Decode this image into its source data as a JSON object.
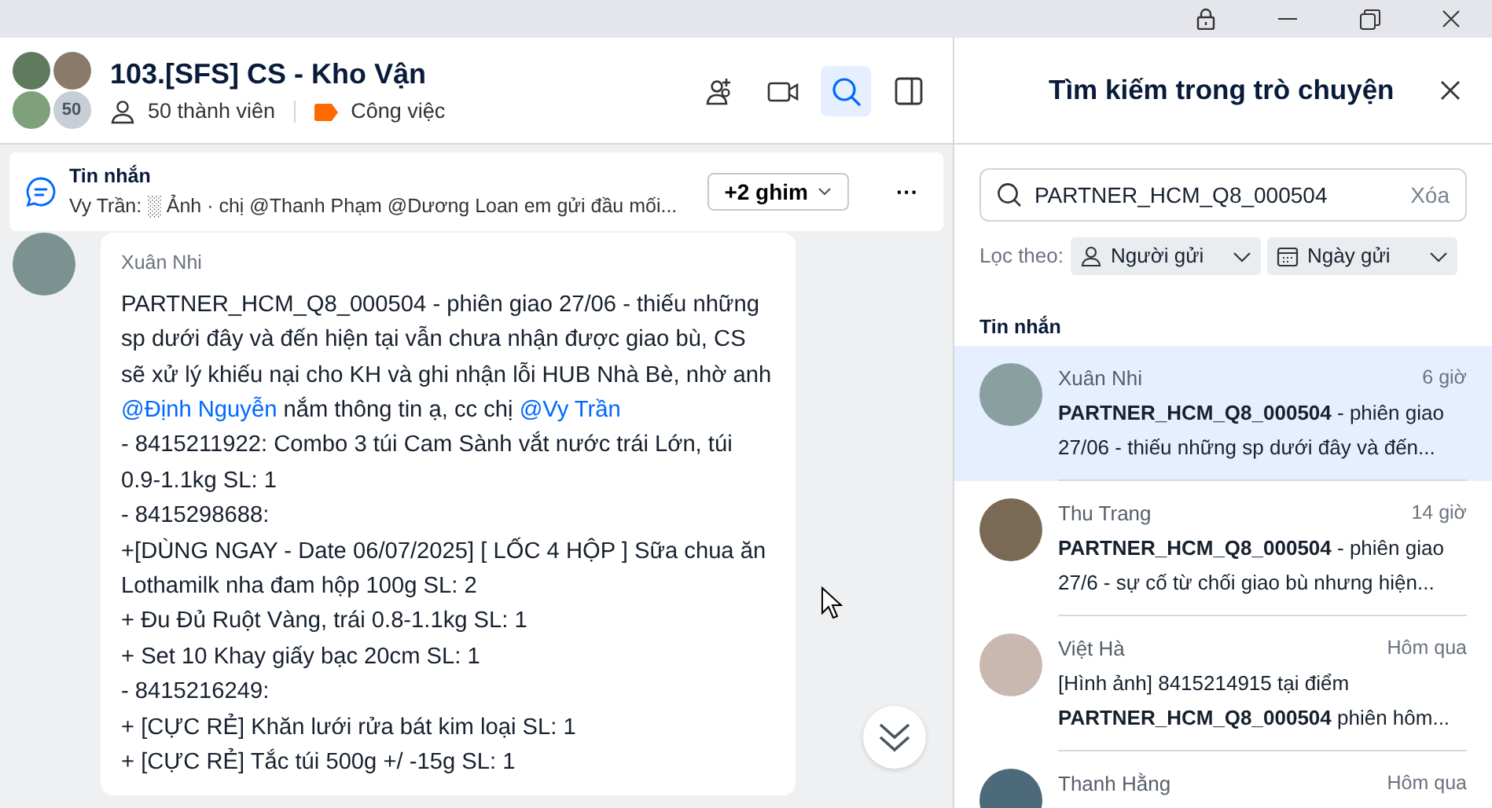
{
  "chat": {
    "title": "103.[SFS] CS - Kho Vận",
    "member_count_badge": "50",
    "members": "50 thành viên",
    "tag": {
      "label": "Công việc",
      "color": "#ff6a00"
    },
    "header_actions": [
      {
        "kind": "add-member",
        "selected": false
      },
      {
        "kind": "video",
        "selected": false
      },
      {
        "kind": "search",
        "selected": true
      },
      {
        "kind": "panel",
        "selected": false
      }
    ],
    "pinned": {
      "title": "Tin nhắn",
      "preview": "Vy Trần: ░ Ảnh · chị @Thanh Phạm @Dương Loan em gửi đầu mối...",
      "pins_button": "+2 ghim",
      "more": "···"
    },
    "message": {
      "sender": "Xuân Nhi",
      "paragraphs": [
        [
          {
            "text": "PARTNER_HCM_Q8_000504 - phiên giao 27/06 - thiếu những sp dưới đây và đến hiện tại vẫn chưa nhận được giao bù, CS sẽ xử lý khiếu nại cho KH và ghi nhận lỗi HUB Nhà Bè, nhờ anh ",
            "mention": false
          },
          {
            "text": "@Định Nguyễn",
            "mention": true
          },
          {
            "text": " nắm thông tin ạ, cc chị ",
            "mention": false
          },
          {
            "text": "@Vy Trần",
            "mention": true
          }
        ],
        [
          {
            "text": "- 8415211922: Combo 3 túi Cam Sành vắt nước trái Lớn, túi 0.9-1.1kg SL: 1",
            "mention": false
          }
        ],
        [
          {
            "text": "- 8415298688:",
            "mention": false
          }
        ],
        [
          {
            "text": "+[DÙNG NGAY - Date 06/07/2025] [ LỐC 4 HỘP ] Sữa chua ăn Lothamilk nha đam hộp 100g SL: 2",
            "mention": false
          }
        ],
        [
          {
            "text": "+ Đu Đủ Ruột Vàng, trái 0.8-1.1kg SL: 1",
            "mention": false
          }
        ],
        [
          {
            "text": "+ Set 10 Khay giấy bạc 20cm SL: 1",
            "mention": false
          }
        ],
        [
          {
            "text": "- 8415216249:",
            "mention": false
          }
        ],
        [
          {
            "text": "+ [CỰC RẺ] Khăn lưới rửa bát kim loại SL: 1",
            "mention": false
          }
        ],
        [
          {
            "text": "+ [CỰC RẺ] Tắc túi 500g +/ -15g   SL:  1",
            "mention": false
          }
        ]
      ]
    }
  },
  "search_panel": {
    "title": "Tìm kiếm trong trò chuyện",
    "query": "PARTNER_HCM_Q8_000504",
    "clear": "Xóa",
    "filter_label": "Lọc theo:",
    "filters": [
      {
        "kind": "person",
        "label": "Người gửi"
      },
      {
        "kind": "calendar",
        "label": "Ngày gửi"
      }
    ],
    "section": "Tin nhắn",
    "results": [
      {
        "sender": "Xuân Nhi",
        "time": "6 giờ",
        "snippet": "**PARTNER_HCM_Q8_000504** - phiên giao 27/06 - thiếu những sp dưới đây và đến...",
        "selected": true
      },
      {
        "sender": "Thu Trang",
        "time": "14 giờ",
        "snippet": "**PARTNER_HCM_Q8_000504** - phiên giao 27/6 - sự cố từ chối giao bù nhưng hiện...",
        "selected": false
      },
      {
        "sender": "Việt Hà",
        "time": "Hôm qua",
        "snippet": "[Hình ảnh] 8415214915 tại điểm **PARTNER_HCM_Q8_000504** phiên hôm...",
        "selected": false
      },
      {
        "sender": "Thanh Hằng",
        "time": "Hôm qua",
        "selected": false
      }
    ]
  }
}
